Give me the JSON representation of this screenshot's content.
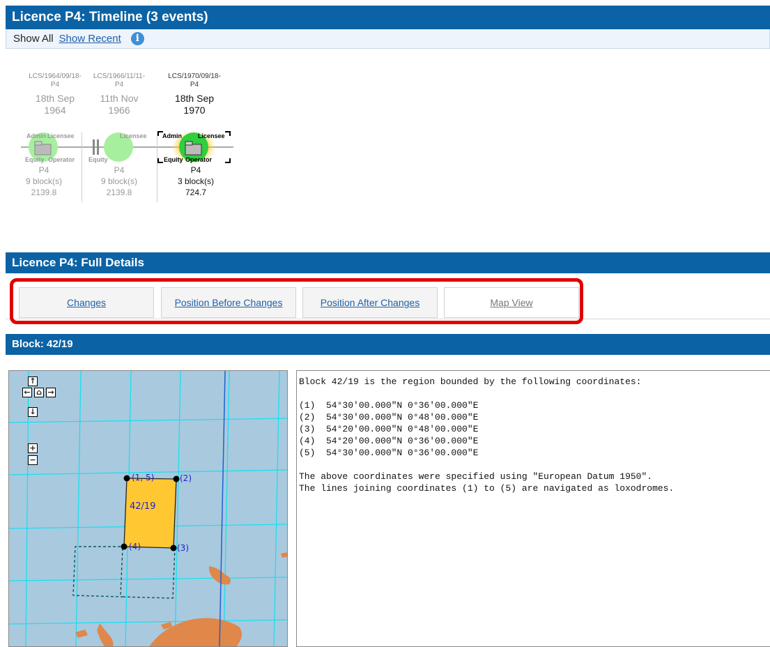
{
  "timeline": {
    "title": "Licence P4: Timeline (3 events)",
    "show_all": "Show All",
    "show_recent": "Show Recent",
    "info_icon": "i",
    "events": [
      {
        "code_line1": "LCS/1964/09/18-",
        "code_line2": "P4",
        "date_line1": "18th Sep",
        "date_line2": "1964",
        "roles": [
          "Admin",
          "Licensee",
          "Equity",
          "Operator"
        ],
        "licence": "P4",
        "blocks": "9 block(s)",
        "area": "2139.8",
        "active": false
      },
      {
        "code_line1": "LCS/1966/11/11-",
        "code_line2": "P4",
        "date_line1": "11th Nov",
        "date_line2": "1966",
        "roles": [
          "Licensee",
          "Equity"
        ],
        "licence": "P4",
        "blocks": "9 block(s)",
        "area": "2139.8",
        "active": false
      },
      {
        "code_line1": "LCS/1970/09/18-",
        "code_line2": "P4",
        "date_line1": "18th Sep",
        "date_line2": "1970",
        "roles": [
          "Admin",
          "Licensee",
          "Equity",
          "Operator"
        ],
        "licence": "P4",
        "blocks": "3 block(s)",
        "area": "724.7",
        "active": true
      }
    ]
  },
  "details": {
    "title": "Licence P4: Full Details",
    "tabs": [
      "Changes",
      "Position Before Changes",
      "Position After Changes",
      "Map View"
    ],
    "selected_tab": "Map View"
  },
  "block": {
    "title": "Block: 42/19",
    "map": {
      "block_label": "42/19",
      "point_labels": [
        "(1, 5)",
        "(2)",
        "(3)",
        "(4)"
      ],
      "nav_icons": [
        "pan-up-icon",
        "pan-left-icon",
        "home-icon",
        "pan-right-icon",
        "pan-down-icon",
        "zoom-in-icon",
        "zoom-out-icon"
      ],
      "colors": {
        "sea": "#a9c9de",
        "grid": "#19e0f0",
        "block_fill": "#ffc833",
        "land": "#e0874a",
        "boundary": "#1f5fd0",
        "label": "#2020d0"
      }
    },
    "description": {
      "intro": "Block 42/19 is the region bounded by the following coordinates:",
      "coords": [
        "(1)  54°30'00.000\"N 0°36'00.000\"E",
        "(2)  54°30'00.000\"N 0°48'00.000\"E",
        "(3)  54°20'00.000\"N 0°48'00.000\"E",
        "(4)  54°20'00.000\"N 0°36'00.000\"E",
        "(5)  54°30'00.000\"N 0°36'00.000\"E"
      ],
      "datum_note": "The above coordinates were specified using \"European Datum 1950\".",
      "lines_note": "The lines joining coordinates (1) to (5) are navigated as loxodromes."
    }
  },
  "colors": {
    "header_bar": "#0b63a5",
    "link": "#1f5fa8",
    "highlight_border": "#e00000"
  }
}
